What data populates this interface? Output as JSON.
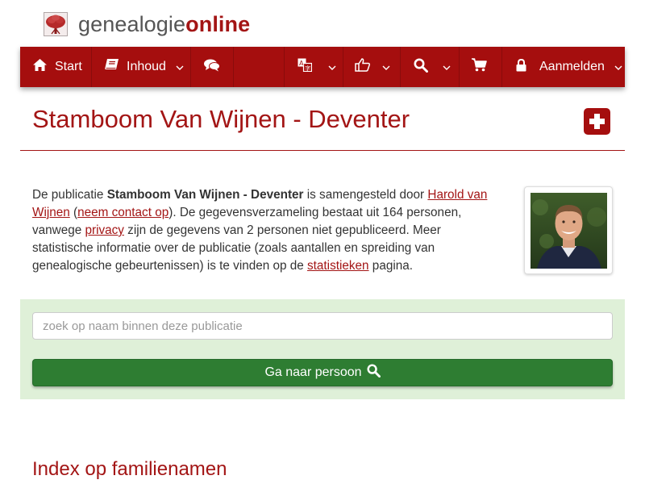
{
  "brand": {
    "name_regular": "genealogie",
    "name_bold": "online"
  },
  "nav": {
    "start": "Start",
    "inhoud": "Inhoud",
    "aanmelden": "Aanmelden",
    "icons": [
      "home-icon",
      "book-icon",
      "comments-icon",
      "language-icon",
      "thumbs-up-icon",
      "search-icon",
      "cart-icon",
      "lock-icon"
    ]
  },
  "page": {
    "title": "Stamboom Van Wijnen - Deventer"
  },
  "intro": {
    "p1": "De publicatie ",
    "pub_name": "Stamboom Van Wijnen - Deventer",
    "p2": " is samengesteld door ",
    "author_link": "Harold van Wijnen",
    "p3": " (",
    "contact_link": "neem contact op",
    "p4": "). De gegevensverzameling bestaat uit 164 personen, vanwege ",
    "privacy_link": "privacy",
    "p5": " zijn de gegevens van 2 personen niet gepubliceerd. Meer statistische informatie over de publicatie (zoals aantallen en spreiding van genealogische gebeurtenissen) is te vinden op de ",
    "stats_link": "statistieken",
    "p6": " pagina."
  },
  "search": {
    "placeholder": "zoek op naam binnen deze publicatie",
    "value": "",
    "button_label": "Ga naar persoon"
  },
  "index": {
    "title": "Index op familienamen"
  },
  "colors": {
    "brand_red": "#a50e0e",
    "panel_green": "#dff0d8",
    "button_green": "#2e7d32"
  }
}
